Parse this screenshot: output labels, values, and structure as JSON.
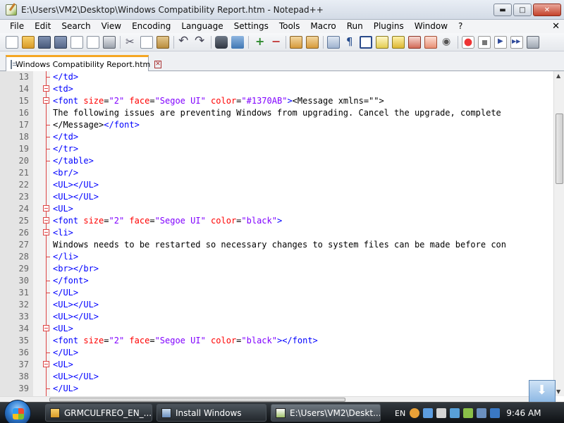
{
  "window": {
    "title": "E:\\Users\\VM2\\Desktop\\Windows Compatibility Report.htm - Notepad++",
    "buttons": {
      "minimize": "▬",
      "maximize": "□",
      "close": "✕"
    }
  },
  "menu": {
    "items": [
      "File",
      "Edit",
      "Search",
      "View",
      "Encoding",
      "Language",
      "Settings",
      "Tools",
      "Macro",
      "Run",
      "Plugins",
      "Window",
      "?"
    ],
    "close": "✕"
  },
  "toolbar": {
    "icons": [
      "new-file-icon",
      "open-file-icon",
      "save-icon",
      "save-all-icon",
      "close-icon",
      "close-all-icon",
      "print-icon",
      "|",
      "cut-icon",
      "copy-icon",
      "paste-icon",
      "|",
      "undo-icon",
      "redo-icon",
      "|",
      "find-icon",
      "replace-icon",
      "|",
      "zoom-in-icon",
      "zoom-out-icon",
      "|",
      "sync-vertical-icon",
      "sync-horizontal-icon",
      "|",
      "word-wrap-icon",
      "show-all-chars-icon",
      "indent-guide-icon",
      "user-lang-icon",
      "doc-map-icon",
      "function-list-icon",
      "folder-as-workspace-icon",
      "monitoring-eye-icon",
      "|",
      "record-macro-icon",
      "stop-macro-icon",
      "play-macro-icon",
      "play-macro-multiple-icon",
      "save-macro-icon"
    ]
  },
  "tab": {
    "label": "Windows Compatibility Report.htm",
    "close": "✕"
  },
  "editor": {
    "lines": [
      {
        "n": "13",
        "fold": "tick",
        "parts": [
          [
            "tag",
            "</td>"
          ]
        ]
      },
      {
        "n": "14",
        "fold": "box",
        "parts": [
          [
            "tag",
            "<td>"
          ]
        ]
      },
      {
        "n": "15",
        "fold": "box",
        "parts": [
          [
            "tag",
            "<font "
          ],
          [
            "attr",
            "size"
          ],
          [
            "eq",
            "="
          ],
          [
            "val",
            "\"2\""
          ],
          [
            "tag",
            " "
          ],
          [
            "attr",
            "face"
          ],
          [
            "eq",
            "="
          ],
          [
            "val",
            "\"Segoe UI\""
          ],
          [
            "tag",
            " "
          ],
          [
            "attr",
            "color"
          ],
          [
            "eq",
            "="
          ],
          [
            "val",
            "\"#1370AB\""
          ],
          [
            "tag",
            ">"
          ],
          [
            "text",
            "<Message xmlns=\"\">"
          ]
        ]
      },
      {
        "n": "16",
        "fold": "",
        "parts": [
          [
            "text",
            "The following issues are preventing Windows from upgrading. Cancel the upgrade, complete"
          ]
        ]
      },
      {
        "n": "17",
        "fold": "tick",
        "parts": [
          [
            "text",
            "</Message>"
          ],
          [
            "tag",
            "</font>"
          ]
        ]
      },
      {
        "n": "18",
        "fold": "tick",
        "parts": [
          [
            "tag",
            "</td>"
          ]
        ]
      },
      {
        "n": "19",
        "fold": "tick",
        "parts": [
          [
            "tag",
            "</tr>"
          ]
        ]
      },
      {
        "n": "20",
        "fold": "tick",
        "parts": [
          [
            "tag",
            "</table>"
          ]
        ]
      },
      {
        "n": "21",
        "fold": "",
        "parts": [
          [
            "tag",
            "<br/>"
          ]
        ]
      },
      {
        "n": "22",
        "fold": "",
        "parts": [
          [
            "tag",
            "<UL></UL>"
          ]
        ]
      },
      {
        "n": "23",
        "fold": "",
        "parts": [
          [
            "tag",
            "<UL></UL>"
          ]
        ]
      },
      {
        "n": "24",
        "fold": "box",
        "parts": [
          [
            "tag",
            "<UL>"
          ]
        ]
      },
      {
        "n": "25",
        "fold": "box",
        "parts": [
          [
            "tag",
            "<font "
          ],
          [
            "attr",
            "size"
          ],
          [
            "eq",
            "="
          ],
          [
            "val",
            "\"2\""
          ],
          [
            "tag",
            " "
          ],
          [
            "attr",
            "face"
          ],
          [
            "eq",
            "="
          ],
          [
            "val",
            "\"Segoe UI\""
          ],
          [
            "tag",
            " "
          ],
          [
            "attr",
            "color"
          ],
          [
            "eq",
            "="
          ],
          [
            "val",
            "\"black\""
          ],
          [
            "tag",
            ">"
          ]
        ]
      },
      {
        "n": "26",
        "fold": "box",
        "parts": [
          [
            "tag",
            "<li>"
          ]
        ]
      },
      {
        "n": "27",
        "fold": "",
        "parts": [
          [
            "text",
            "Windows needs to be restarted so necessary changes to system files can be made before con"
          ]
        ]
      },
      {
        "n": "28",
        "fold": "tick",
        "parts": [
          [
            "tag",
            "</li>"
          ]
        ]
      },
      {
        "n": "29",
        "fold": "",
        "parts": [
          [
            "tag",
            "<br></br>"
          ]
        ]
      },
      {
        "n": "30",
        "fold": "tick",
        "parts": [
          [
            "tag",
            "</font>"
          ]
        ]
      },
      {
        "n": "31",
        "fold": "tick",
        "parts": [
          [
            "tag",
            "</UL>"
          ]
        ]
      },
      {
        "n": "32",
        "fold": "",
        "parts": [
          [
            "tag",
            "<UL></UL>"
          ]
        ]
      },
      {
        "n": "33",
        "fold": "",
        "parts": [
          [
            "tag",
            "<UL></UL>"
          ]
        ]
      },
      {
        "n": "34",
        "fold": "box",
        "parts": [
          [
            "tag",
            "<UL>"
          ]
        ]
      },
      {
        "n": "35",
        "fold": "",
        "parts": [
          [
            "tag",
            "<font "
          ],
          [
            "attr",
            "size"
          ],
          [
            "eq",
            "="
          ],
          [
            "val",
            "\"2\""
          ],
          [
            "tag",
            " "
          ],
          [
            "attr",
            "face"
          ],
          [
            "eq",
            "="
          ],
          [
            "val",
            "\"Segoe UI\""
          ],
          [
            "tag",
            " "
          ],
          [
            "attr",
            "color"
          ],
          [
            "eq",
            "="
          ],
          [
            "val",
            "\"black\""
          ],
          [
            "tag",
            "></font>"
          ]
        ]
      },
      {
        "n": "36",
        "fold": "tick",
        "parts": [
          [
            "tag",
            "</UL>"
          ]
        ]
      },
      {
        "n": "37",
        "fold": "box",
        "parts": [
          [
            "tag",
            "<UL>"
          ]
        ]
      },
      {
        "n": "38",
        "fold": "",
        "parts": [
          [
            "tag",
            "<UL></UL>"
          ]
        ]
      },
      {
        "n": "39",
        "fold": "tick",
        "parts": [
          [
            "tag",
            "</UL>"
          ]
        ]
      }
    ]
  },
  "taskbar": {
    "tasks": [
      {
        "label": "GRMCULFREO_EN_...",
        "icon": "folder-icon"
      },
      {
        "label": "Install Windows",
        "icon": "setup-icon"
      },
      {
        "label": "E:\\Users\\VM2\\Deskt...",
        "icon": "notepadpp-icon"
      }
    ],
    "tray_lang": "EN",
    "clock": "9:46 AM"
  },
  "colors": {
    "tag": "#0000ff",
    "attr": "#ff0000",
    "value": "#8000ff",
    "fold": "#dd4444",
    "tab_accent": "#f5a623"
  }
}
